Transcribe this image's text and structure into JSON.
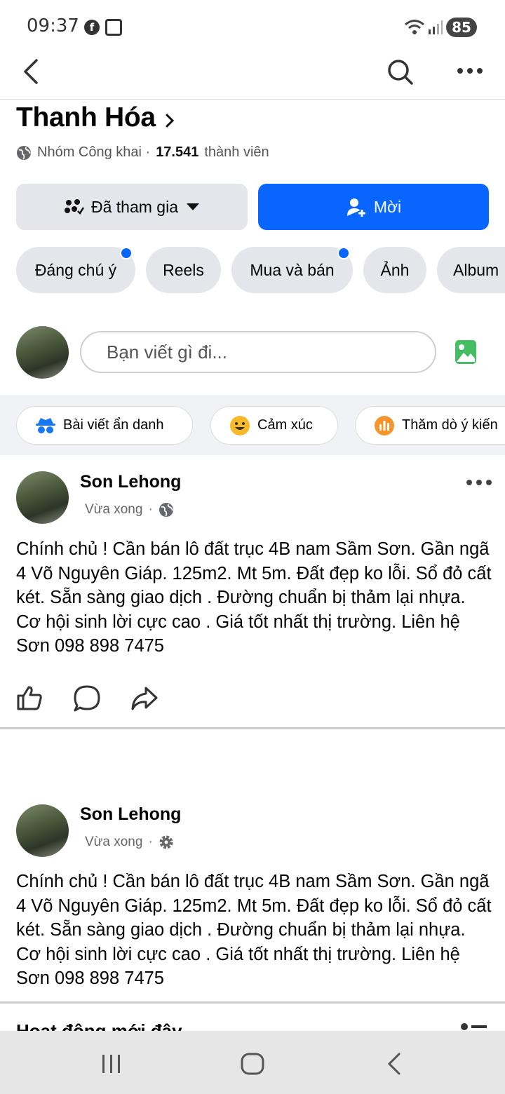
{
  "status_bar": {
    "time": "09:37",
    "battery": "85"
  },
  "group": {
    "name": "Thanh Hóa",
    "privacy": "Nhóm Công khai ·",
    "member_count": "17.541",
    "member_label": "thành viên"
  },
  "buttons": {
    "joined": "Đã tham gia",
    "invite": "Mời"
  },
  "tabs": [
    {
      "label": "Đáng chú ý",
      "badge": true
    },
    {
      "label": "Reels",
      "badge": false
    },
    {
      "label": "Mua và bán",
      "badge": true
    },
    {
      "label": "Ảnh",
      "badge": false
    },
    {
      "label": "Album",
      "badge": false
    }
  ],
  "composer": {
    "placeholder": "Bạn viết gì đi..."
  },
  "chips": [
    {
      "label": "Bài viết ẩn danh",
      "icon": "incognito-icon",
      "color": "#1877f2"
    },
    {
      "label": "Cảm xúc",
      "icon": "smile-icon",
      "color": "#f7b928"
    },
    {
      "label": "Thăm dò ý kiến",
      "icon": "poll-icon",
      "color": "#f5952b"
    }
  ],
  "posts": [
    {
      "author": "Son Lehong",
      "time": "Vừa xong",
      "privacy_icon": "globe-icon",
      "text": "Chính chủ ! Cần bán lô đất trục 4B nam Sầm Sơn. Gần ngã 4 Võ Nguyên Giáp. 125m2. Mt 5m. Đất đẹp ko lỗi. Sổ đỏ cất két. Sẵn sàng giao dịch . Đường chuẩn bị thảm lại nhựa. Cơ hội sinh lời cực cao . Giá tốt nhất thị trường. Liên hệ Sơn 098 898 7475"
    },
    {
      "author": "Son Lehong",
      "time": "Vừa xong",
      "privacy_icon": "gear-icon",
      "text": "Chính chủ ! Cần bán lô đất trục 4B nam Sầm Sơn. Gần ngã 4 Võ Nguyên Giáp. 125m2. Mt 5m. Đất đẹp ko lỗi. Sổ đỏ cất két. Sẵn sàng giao dịch . Đường chuẩn bị thảm lại nhựa. Cơ hội sinh lời cực cao . Giá tốt nhất thị trường. Liên hệ Sơn 098 898 7475"
    }
  ],
  "section": {
    "recent_activity": "Hoạt động mới đây"
  },
  "colors": {
    "accent": "#0866ff",
    "chip_bg": "#e4e6eb"
  }
}
